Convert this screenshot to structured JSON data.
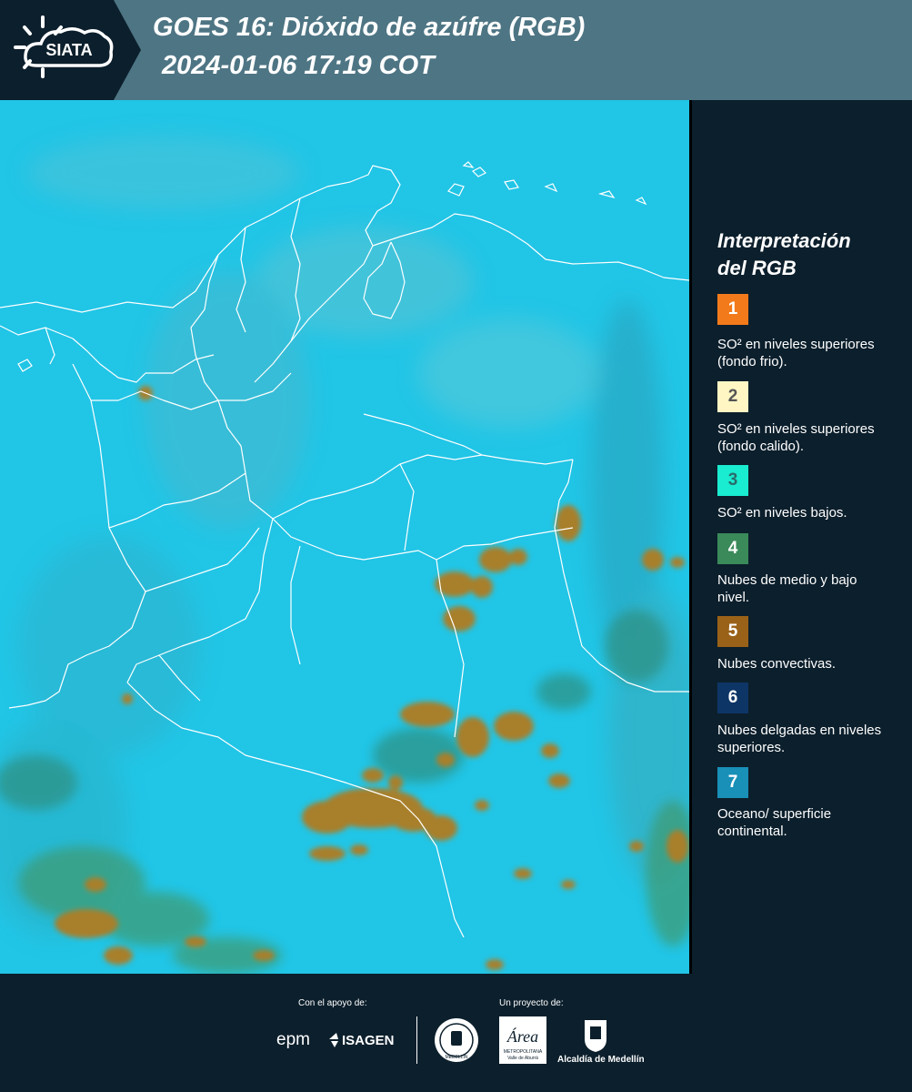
{
  "header": {
    "brand": "SIATA",
    "title": "GOES 16: Dióxido de azúfre (RGB)",
    "datetime": "2024-01-06 17:19 COT"
  },
  "legend": {
    "title_line1": "Interpretación",
    "title_line2": "del RGB",
    "items": [
      {
        "num": "1",
        "color": "#f37a1b",
        "text_color": "#ffffff",
        "label": "SO² en niveles superiores (fondo frio)."
      },
      {
        "num": "2",
        "color": "#fff6c4",
        "text_color": "#555555",
        "label": "SO² en niveles superiores (fondo calido)."
      },
      {
        "num": "3",
        "color": "#19ecd0",
        "text_color": "#2a6b6b",
        "label": "SO² en niveles bajos."
      },
      {
        "num": "4",
        "color": "#3a8a5a",
        "text_color": "#ffffff",
        "label": "Nubes de medio y bajo nivel."
      },
      {
        "num": "5",
        "color": "#9a6218",
        "text_color": "#ffffff",
        "label": "Nubes convectivas."
      },
      {
        "num": "6",
        "color": "#0d3566",
        "text_color": "#ffffff",
        "label": "Nubes delgadas en niveles superiores."
      },
      {
        "num": "7",
        "color": "#1890b8",
        "text_color": "#ffffff",
        "label": "Oceano/ superficie continental."
      }
    ]
  },
  "footer": {
    "support_label": "Con el apoyo de:",
    "project_label": "Un proyecto de:",
    "sponsor_epm": "epm",
    "sponsor_isagen": "ISAGEN",
    "area_name": "Área",
    "area_sub1": "METROPOLITANA",
    "area_sub2": "Valle de Aburrá",
    "alcaldia": "Alcaldía de Medellín",
    "seal_text": "MEDELLÍN"
  },
  "map": {
    "background_color": "#21c5e6",
    "border_color": "#ffffff",
    "cloud_colors": [
      "#a87f2c",
      "#2e8f80"
    ]
  }
}
